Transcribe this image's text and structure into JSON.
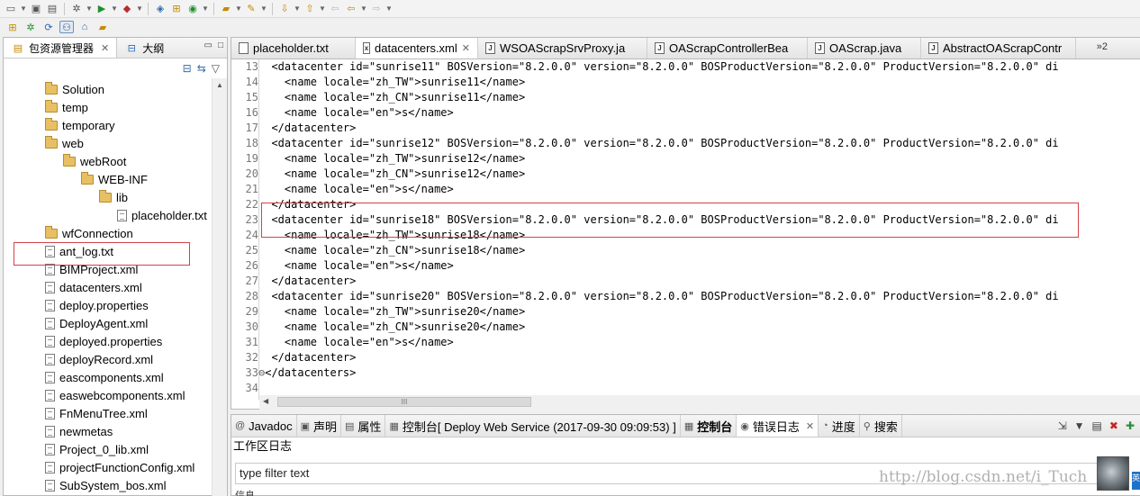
{
  "left_panel": {
    "tabs": [
      {
        "label": "包资源管理器",
        "icon": "package-explorer-icon"
      },
      {
        "label": "大纲",
        "icon": "outline-icon"
      }
    ],
    "tree": [
      {
        "label": "Solution",
        "type": "folder",
        "depth": 0
      },
      {
        "label": "temp",
        "type": "folder",
        "depth": 0
      },
      {
        "label": "temporary",
        "type": "folder",
        "depth": 0
      },
      {
        "label": "web",
        "type": "folder",
        "depth": 0
      },
      {
        "label": "webRoot",
        "type": "folder",
        "depth": 1
      },
      {
        "label": "WEB-INF",
        "type": "folder",
        "depth": 2
      },
      {
        "label": "lib",
        "type": "folder",
        "depth": 3
      },
      {
        "label": "placeholder.txt",
        "type": "file",
        "depth": 4
      },
      {
        "label": "wfConnection",
        "type": "folder",
        "depth": 0
      },
      {
        "label": "ant_log.txt",
        "type": "file",
        "depth": 0
      },
      {
        "label": "BIMProject.xml",
        "type": "file",
        "depth": 0
      },
      {
        "label": "datacenters.xml",
        "type": "file",
        "depth": 0,
        "highlighted": true
      },
      {
        "label": "deploy.properties",
        "type": "file",
        "depth": 0
      },
      {
        "label": "DeployAgent.xml",
        "type": "file",
        "depth": 0
      },
      {
        "label": "deployed.properties",
        "type": "file",
        "depth": 0
      },
      {
        "label": "deployRecord.xml",
        "type": "file",
        "depth": 0
      },
      {
        "label": "eascomponents.xml",
        "type": "file",
        "depth": 0
      },
      {
        "label": "easwebcomponents.xml",
        "type": "file",
        "depth": 0
      },
      {
        "label": "FnMenuTree.xml",
        "type": "file",
        "depth": 0
      },
      {
        "label": "newmetas",
        "type": "file",
        "depth": 0
      },
      {
        "label": "Project_0_lib.xml",
        "type": "file",
        "depth": 0
      },
      {
        "label": "projectFunctionConfig.xml",
        "type": "file",
        "depth": 0
      },
      {
        "label": "SubSystem_bos.xml",
        "type": "file",
        "depth": 0
      }
    ]
  },
  "editor": {
    "tabs": [
      {
        "label": "placeholder.txt",
        "icon": "text-file-icon"
      },
      {
        "label": "datacenters.xml",
        "icon": "xml-file-icon",
        "active": true
      },
      {
        "label": "WSOAScrapSrvProxy.ja",
        "icon": "java-file-icon"
      },
      {
        "label": "OAScrapControllerBea",
        "icon": "java-file-icon"
      },
      {
        "label": "OAScrap.java",
        "icon": "java-file-icon"
      },
      {
        "label": "AbstractOAScrapContr",
        "icon": "java-file-icon"
      }
    ],
    "overflow_tabs": "»2",
    "lines": [
      {
        "num": "13",
        "marker": "",
        "text": "  <datacenter id=\"sunrise11\" BOSVersion=\"8.2.0.0\" version=\"8.2.0.0\" BOSProductVersion=\"8.2.0.0\" ProductVersion=\"8.2.0.0\" di"
      },
      {
        "num": "14",
        "marker": "",
        "text": "    <name locale=\"zh_TW\">sunrise11</name>"
      },
      {
        "num": "15",
        "marker": "",
        "text": "    <name locale=\"zh_CN\">sunrise11</name>"
      },
      {
        "num": "16",
        "marker": "",
        "text": "    <name locale=\"en\">s</name>"
      },
      {
        "num": "17",
        "marker": "",
        "text": "  </datacenter>"
      },
      {
        "num": "18",
        "marker": "",
        "text": "  <datacenter id=\"sunrise12\" BOSVersion=\"8.2.0.0\" version=\"8.2.0.0\" BOSProductVersion=\"8.2.0.0\" ProductVersion=\"8.2.0.0\" di"
      },
      {
        "num": "19",
        "marker": "",
        "text": "    <name locale=\"zh_TW\">sunrise12</name>"
      },
      {
        "num": "20",
        "marker": "",
        "text": "    <name locale=\"zh_CN\">sunrise12</name>"
      },
      {
        "num": "21",
        "marker": "",
        "text": "    <name locale=\"en\">s</name>"
      },
      {
        "num": "22",
        "marker": "",
        "text": "  </datacenter>"
      },
      {
        "num": "23",
        "marker": "",
        "text": "  <datacenter id=\"sunrise18\" BOSVersion=\"8.2.0.0\" version=\"8.2.0.0\" BOSProductVersion=\"8.2.0.0\" ProductVersion=\"8.2.0.0\" di"
      },
      {
        "num": "24",
        "marker": "",
        "text": "    <name locale=\"zh_TW\">sunrise18</name>"
      },
      {
        "num": "25",
        "marker": "",
        "text": "    <name locale=\"zh_CN\">sunrise18</name>"
      },
      {
        "num": "26",
        "marker": "",
        "text": "    <name locale=\"en\">s</name>"
      },
      {
        "num": "27",
        "marker": "",
        "text": "  </datacenter>"
      },
      {
        "num": "28",
        "marker": "",
        "text": "  <datacenter id=\"sunrise20\" BOSVersion=\"8.2.0.0\" version=\"8.2.0.0\" BOSProductVersion=\"8.2.0.0\" ProductVersion=\"8.2.0.0\" di"
      },
      {
        "num": "29",
        "marker": "",
        "text": "    <name locale=\"zh_TW\">sunrise20</name>"
      },
      {
        "num": "30",
        "marker": "",
        "text": "    <name locale=\"zh_CN\">sunrise20</name>"
      },
      {
        "num": "31",
        "marker": "",
        "text": "    <name locale=\"en\">s</name>"
      },
      {
        "num": "32",
        "marker": "",
        "text": "  </datacenter>"
      },
      {
        "num": "33",
        "marker": "⊖",
        "text": "</datacenters>"
      },
      {
        "num": "34",
        "marker": "",
        "text": ""
      }
    ],
    "scroll_grip": "III"
  },
  "bottom_panel": {
    "tabs": [
      {
        "label": "Javadoc",
        "icon": "at-icon"
      },
      {
        "label": "声明",
        "icon": "declaration-icon"
      },
      {
        "label": "属性",
        "icon": "properties-icon"
      },
      {
        "label": "控制台[  Deploy Web Service (2017-09-30 09:09:53) ]",
        "icon": "console-icon"
      },
      {
        "label": "控制台",
        "icon": "console-icon"
      },
      {
        "label": "错误日志",
        "icon": "error-log-icon",
        "active": true
      },
      {
        "label": "进度",
        "icon": "progress-icon"
      },
      {
        "label": "搜索",
        "icon": "search-icon"
      }
    ],
    "log_title": "工作区日志",
    "filter_value": "type filter text",
    "column_header": "信息"
  },
  "watermark": "http://blog.csdn.net/i_Tuch",
  "corner_tag": "英",
  "colors": {
    "highlight_box": "#d6404a",
    "folder": "#e8c063",
    "line_number": "#787878"
  }
}
